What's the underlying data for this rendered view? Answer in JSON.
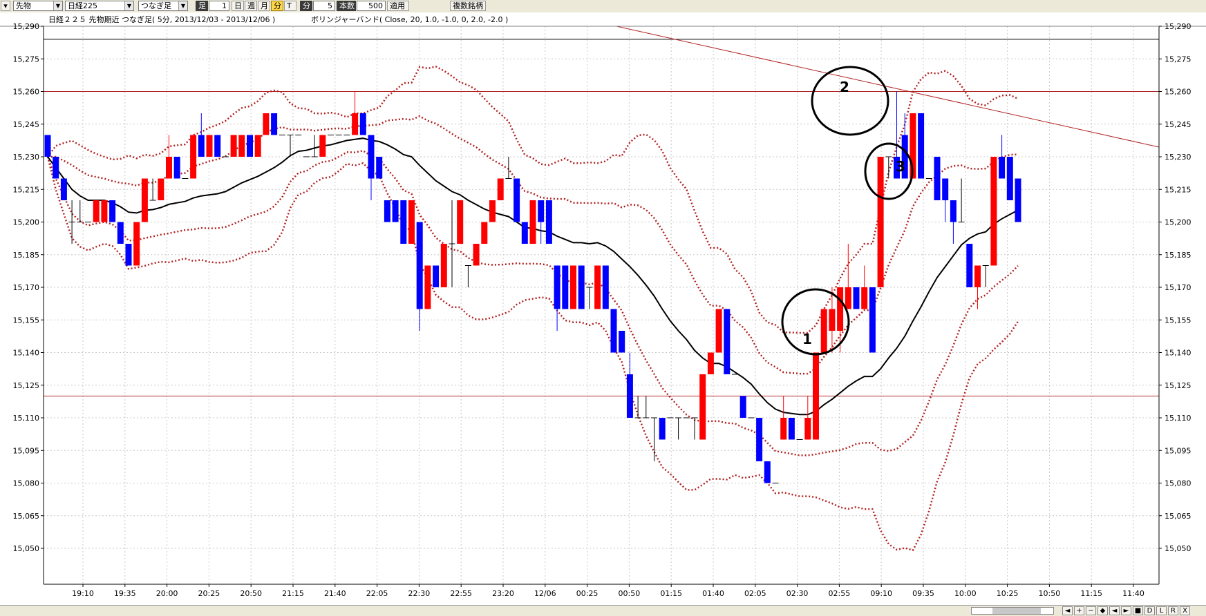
{
  "toolbar": {
    "market": "先物",
    "symbol": "日経225",
    "continuation": "つなぎ足",
    "bar_label": "足",
    "bar_count": "1",
    "period_day": "日",
    "period_week": "週",
    "period_month": "月",
    "period_minute": "分",
    "period_tick": "T",
    "minute_label": "分",
    "minute_value": "5",
    "bars_label": "本数",
    "bars_value": "500",
    "apply": "適用",
    "multi_symbol": "複数銘柄"
  },
  "chart_data": {
    "type": "candlestick",
    "title": "日経２２５ 先物期近 つなぎ足( 5分, 2013/12/03 - 2013/12/06 )",
    "indicator": "ボリンジャーバンド( Close, 20, 1.0, -1.0, 0, 2.0, -2.0 )",
    "y_ticks": [
      15290,
      15275,
      15260,
      15245,
      15230,
      15215,
      15200,
      15185,
      15170,
      15155,
      15140,
      15125,
      15110,
      15095,
      15080,
      15065,
      15050
    ],
    "y_tick_labels": [
      "15,290",
      "15,275",
      "15,260",
      "15,245",
      "15,230",
      "15,215",
      "15,200",
      "15,185",
      "15,170",
      "15,155",
      "15,140",
      "15,125",
      "15,110",
      "15,095",
      "15,080",
      "15,065",
      "15,050"
    ],
    "x_tick_labels": [
      "19:10",
      "19:35",
      "20:00",
      "20:25",
      "20:50",
      "21:15",
      "21:40",
      "22:05",
      "22:30",
      "22:55",
      "23:20",
      "12/06",
      "00:25",
      "00:50",
      "01:15",
      "01:40",
      "02:05",
      "02:30",
      "02:55",
      "09:10",
      "09:35",
      "10:00",
      "10:25",
      "10:50",
      "11:15",
      "11:40"
    ],
    "horizontal_lines": [
      15284,
      15260,
      15120
    ],
    "candles": [
      {
        "o": 15240,
        "h": 15240,
        "l": 15230,
        "c": 15230
      },
      {
        "o": 15230,
        "h": 15230,
        "l": 15220,
        "c": 15220
      },
      {
        "o": 15220,
        "h": 15220,
        "l": 15210,
        "c": 15210
      },
      {
        "o": 15200,
        "h": 15210,
        "l": 15190,
        "c": 15200
      },
      {
        "o": 15200,
        "h": 15210,
        "l": 15200,
        "c": 15200
      },
      {
        "o": 15200,
        "h": 15200,
        "l": 15200,
        "c": 15200
      },
      {
        "o": 15200,
        "h": 15210,
        "l": 15200,
        "c": 15210
      },
      {
        "o": 15200,
        "h": 15210,
        "l": 15200,
        "c": 15210
      },
      {
        "o": 15210,
        "h": 15210,
        "l": 15200,
        "c": 15200
      },
      {
        "o": 15200,
        "h": 15200,
        "l": 15190,
        "c": 15190
      },
      {
        "o": 15190,
        "h": 15190,
        "l": 15180,
        "c": 15180
      },
      {
        "o": 15180,
        "h": 15200,
        "l": 15180,
        "c": 15200
      },
      {
        "o": 15200,
        "h": 15220,
        "l": 15200,
        "c": 15220
      },
      {
        "o": 15210,
        "h": 15220,
        "l": 15210,
        "c": 15210
      },
      {
        "o": 15210,
        "h": 15220,
        "l": 15210,
        "c": 15220
      },
      {
        "o": 15220,
        "h": 15240,
        "l": 15220,
        "c": 15230
      },
      {
        "o": 15230,
        "h": 15230,
        "l": 15220,
        "c": 15220
      },
      {
        "o": 15220,
        "h": 15220,
        "l": 15220,
        "c": 15220
      },
      {
        "o": 15220,
        "h": 15240,
        "l": 15220,
        "c": 15240
      },
      {
        "o": 15240,
        "h": 15250,
        "l": 15230,
        "c": 15230
      },
      {
        "o": 15230,
        "h": 15240,
        "l": 15230,
        "c": 15240
      },
      {
        "o": 15240,
        "h": 15240,
        "l": 15230,
        "c": 15230
      },
      {
        "o": 15230,
        "h": 15230,
        "l": 15230,
        "c": 15230
      },
      {
        "o": 15230,
        "h": 15240,
        "l": 15230,
        "c": 15240
      },
      {
        "o": 15230,
        "h": 15240,
        "l": 15230,
        "c": 15240
      },
      {
        "o": 15240,
        "h": 15240,
        "l": 15230,
        "c": 15230
      },
      {
        "o": 15230,
        "h": 15240,
        "l": 15230,
        "c": 15240
      },
      {
        "o": 15240,
        "h": 15250,
        "l": 15240,
        "c": 15250
      },
      {
        "o": 15250,
        "h": 15250,
        "l": 15240,
        "c": 15240
      },
      {
        "o": 15240,
        "h": 15240,
        "l": 15240,
        "c": 15240
      },
      {
        "o": 15240,
        "h": 15240,
        "l": 15230,
        "c": 15240
      },
      {
        "o": 15240,
        "h": 15240,
        "l": 15240,
        "c": 15240
      },
      {
        "o": 15230,
        "h": 15230,
        "l": 15230,
        "c": 15230
      },
      {
        "o": 15230,
        "h": 15240,
        "l": 15230,
        "c": 15230
      },
      {
        "o": 15230,
        "h": 15240,
        "l": 15230,
        "c": 15240
      },
      {
        "o": 15240,
        "h": 15240,
        "l": 15240,
        "c": 15240
      },
      {
        "o": 15240,
        "h": 15240,
        "l": 15240,
        "c": 15240
      },
      {
        "o": 15240,
        "h": 15240,
        "l": 15240,
        "c": 15240
      },
      {
        "o": 15240,
        "h": 15260,
        "l": 15240,
        "c": 15250
      },
      {
        "o": 15250,
        "h": 15250,
        "l": 15240,
        "c": 15240
      },
      {
        "o": 15240,
        "h": 15230,
        "l": 15210,
        "c": 15220
      },
      {
        "o": 15230,
        "h": 15230,
        "l": 15220,
        "c": 15220
      },
      {
        "o": 15210,
        "h": 15210,
        "l": 15200,
        "c": 15200
      },
      {
        "o": 15210,
        "h": 15210,
        "l": 15200,
        "c": 15200
      },
      {
        "o": 15210,
        "h": 15210,
        "l": 15190,
        "c": 15190
      },
      {
        "o": 15190,
        "h": 15210,
        "l": 15190,
        "c": 15210
      },
      {
        "o": 15200,
        "h": 15200,
        "l": 15150,
        "c": 15160
      },
      {
        "o": 15160,
        "h": 15180,
        "l": 15160,
        "c": 15180
      },
      {
        "o": 15180,
        "h": 15180,
        "l": 15170,
        "c": 15170
      },
      {
        "o": 15170,
        "h": 15190,
        "l": 15170,
        "c": 15190
      },
      {
        "o": 15190,
        "h": 15210,
        "l": 15170,
        "c": 15190
      },
      {
        "o": 15190,
        "h": 15210,
        "l": 15190,
        "c": 15210
      },
      {
        "o": 15180,
        "h": 15180,
        "l": 15170,
        "c": 15180
      },
      {
        "o": 15180,
        "h": 15190,
        "l": 15180,
        "c": 15190
      },
      {
        "o": 15190,
        "h": 15200,
        "l": 15190,
        "c": 15200
      },
      {
        "o": 15200,
        "h": 15210,
        "l": 15200,
        "c": 15210
      },
      {
        "o": 15210,
        "h": 15220,
        "l": 15210,
        "c": 15220
      },
      {
        "o": 15220,
        "h": 15230,
        "l": 15220,
        "c": 15220
      },
      {
        "o": 15220,
        "h": 15220,
        "l": 15200,
        "c": 15200
      },
      {
        "o": 15200,
        "h": 15200,
        "l": 15190,
        "c": 15190
      },
      {
        "o": 15190,
        "h": 15210,
        "l": 15190,
        "c": 15210
      },
      {
        "o": 15210,
        "h": 15210,
        "l": 15190,
        "c": 15200
      },
      {
        "o": 15210,
        "h": 15210,
        "l": 15190,
        "c": 15190
      },
      {
        "o": 15180,
        "h": 15180,
        "l": 15150,
        "c": 15160
      },
      {
        "o": 15180,
        "h": 15180,
        "l": 15160,
        "c": 15160
      },
      {
        "o": 15160,
        "h": 15180,
        "l": 15160,
        "c": 15180
      },
      {
        "o": 15180,
        "h": 15180,
        "l": 15160,
        "c": 15160
      },
      {
        "o": 15170,
        "h": 15170,
        "l": 15160,
        "c": 15170
      },
      {
        "o": 15160,
        "h": 15180,
        "l": 15160,
        "c": 15180
      },
      {
        "o": 15180,
        "h": 15180,
        "l": 15160,
        "c": 15160
      },
      {
        "o": 15160,
        "h": 15160,
        "l": 15140,
        "c": 15140
      },
      {
        "o": 15150,
        "h": 15150,
        "l": 15140,
        "c": 15140
      },
      {
        "o": 15130,
        "h": 15140,
        "l": 15110,
        "c": 15110
      },
      {
        "o": 15110,
        "h": 15120,
        "l": 15110,
        "c": 15110
      },
      {
        "o": 15110,
        "h": 15120,
        "l": 15110,
        "c": 15110
      },
      {
        "o": 15110,
        "h": 15110,
        "l": 15090,
        "c": 15110
      },
      {
        "o": 15110,
        "h": 15110,
        "l": 15100,
        "c": 15100
      },
      {
        "o": 15110,
        "h": 15110,
        "l": 15110,
        "c": 15110
      },
      {
        "o": 15110,
        "h": 15110,
        "l": 15100,
        "c": 15110
      },
      {
        "o": 15110,
        "h": 15110,
        "l": 15110,
        "c": 15110
      },
      {
        "o": 15110,
        "h": 15110,
        "l": 15100,
        "c": 15110
      },
      {
        "o": 15100,
        "h": 15130,
        "l": 15100,
        "c": 15130
      },
      {
        "o": 15130,
        "h": 15140,
        "l": 15130,
        "c": 15140
      },
      {
        "o": 15140,
        "h": 15160,
        "l": 15140,
        "c": 15160
      },
      {
        "o": 15160,
        "h": 15160,
        "l": 15150,
        "c": 15130
      },
      {
        "o": 15130,
        "h": 15130,
        "l": 15130,
        "c": 15130
      },
      {
        "o": 15120,
        "h": 15120,
        "l": 15110,
        "c": 15110
      },
      {
        "o": 15110,
        "h": 15110,
        "l": 15110,
        "c": 15110
      },
      {
        "o": 15110,
        "h": 15110,
        "l": 15090,
        "c": 15090
      },
      {
        "o": 15090,
        "h": 15090,
        "l": 15080,
        "c": 15080
      },
      {
        "o": 15080,
        "h": 15080,
        "l": 15080,
        "c": 15080
      },
      {
        "o": 15100,
        "h": 15120,
        "l": 15100,
        "c": 15110
      },
      {
        "o": 15110,
        "h": 15110,
        "l": 15100,
        "c": 15100
      },
      {
        "o": 15100,
        "h": 15100,
        "l": 15100,
        "c": 15100
      },
      {
        "o": 15100,
        "h": 15120,
        "l": 15100,
        "c": 15110
      },
      {
        "o": 15100,
        "h": 15140,
        "l": 15100,
        "c": 15140
      },
      {
        "o": 15140,
        "h": 15160,
        "l": 15140,
        "c": 15160
      },
      {
        "o": 15150,
        "h": 15170,
        "l": 15140,
        "c": 15160
      },
      {
        "o": 15150,
        "h": 15170,
        "l": 15140,
        "c": 15170
      },
      {
        "o": 15160,
        "h": 15190,
        "l": 15160,
        "c": 15170
      },
      {
        "o": 15170,
        "h": 15170,
        "l": 15160,
        "c": 15160
      },
      {
        "o": 15160,
        "h": 15180,
        "l": 15160,
        "c": 15170
      },
      {
        "o": 15170,
        "h": 15170,
        "l": 15140,
        "c": 15140
      },
      {
        "o": 15170,
        "h": 15230,
        "l": 15170,
        "c": 15230
      },
      {
        "o": 15230,
        "h": 15230,
        "l": 15220,
        "c": 15230
      },
      {
        "o": 15230,
        "h": 15260,
        "l": 15220,
        "c": 15220
      },
      {
        "o": 15240,
        "h": 15250,
        "l": 15220,
        "c": 15220
      },
      {
        "o": 15220,
        "h": 15250,
        "l": 15220,
        "c": 15250
      },
      {
        "o": 15250,
        "h": 15250,
        "l": 15220,
        "c": 15220
      },
      {
        "o": 15220,
        "h": 15220,
        "l": 15220,
        "c": 15220
      },
      {
        "o": 15230,
        "h": 15230,
        "l": 15210,
        "c": 15210
      },
      {
        "o": 15220,
        "h": 15220,
        "l": 15200,
        "c": 15210
      },
      {
        "o": 15210,
        "h": 15210,
        "l": 15190,
        "c": 15200
      },
      {
        "o": 15200,
        "h": 15220,
        "l": 15200,
        "c": 15200
      },
      {
        "o": 15190,
        "h": 15190,
        "l": 15170,
        "c": 15170
      },
      {
        "o": 15170,
        "h": 15180,
        "l": 15160,
        "c": 15180
      },
      {
        "o": 15180,
        "h": 15180,
        "l": 15170,
        "c": 15180
      },
      {
        "o": 15180,
        "h": 15230,
        "l": 15180,
        "c": 15230
      },
      {
        "o": 15230,
        "h": 15240,
        "l": 15220,
        "c": 15220
      },
      {
        "o": 15230,
        "h": 15230,
        "l": 15210,
        "c": 15210
      },
      {
        "o": 15220,
        "h": 15220,
        "l": 15200,
        "c": 15200
      }
    ],
    "candle_colors": {
      "up": "#ff0000",
      "down": "#0000ff"
    },
    "band_color": "#b22222",
    "annotations": [
      {
        "label": "1",
        "price": 15145
      },
      {
        "label": "2",
        "price": 15250
      },
      {
        "label": "3",
        "price": 15220
      }
    ]
  },
  "scrollbar": {
    "buttons": [
      "◄",
      "+",
      "−",
      "◆",
      "◄",
      "►",
      "■",
      "D",
      "L",
      "R",
      "X"
    ]
  }
}
